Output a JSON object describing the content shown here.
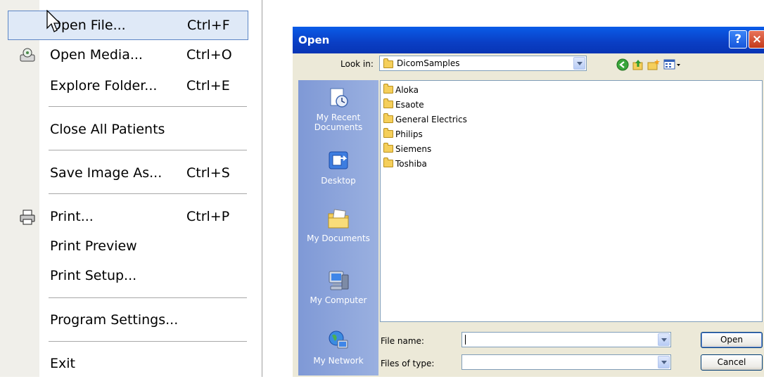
{
  "menu": {
    "items": [
      {
        "label": "Open File...",
        "shortcut": "Ctrl+F"
      },
      {
        "label": "Open Media...",
        "shortcut": "Ctrl+O"
      },
      {
        "label": "Explore Folder...",
        "shortcut": "Ctrl+E"
      },
      {
        "label": "Close All Patients",
        "shortcut": ""
      },
      {
        "label": "Save Image As...",
        "shortcut": "Ctrl+S"
      },
      {
        "label": "Print...",
        "shortcut": "Ctrl+P"
      },
      {
        "label": "Print Preview",
        "shortcut": ""
      },
      {
        "label": "Print Setup...",
        "shortcut": ""
      },
      {
        "label": "Program Settings...",
        "shortcut": ""
      },
      {
        "label": "Exit",
        "shortcut": ""
      }
    ],
    "icons": [
      "media-icon",
      "printer-icon"
    ]
  },
  "dialog": {
    "title": "Open",
    "help_label": "?",
    "close_label": "×",
    "look_in_label": "Look in:",
    "look_in_value": "DicomSamples",
    "places": [
      "My Recent Documents",
      "Desktop",
      "My Documents",
      "My Computer",
      "My Network"
    ],
    "places_lines": {
      "recent_1": "My Recent",
      "recent_2": "Documents"
    },
    "folders": [
      "Aloka",
      "Esaote",
      "General Electrics",
      "Philips",
      "Siemens",
      "Toshiba"
    ],
    "file_name_label": "File name:",
    "file_name_value": "",
    "files_of_type_label": "Files of type:",
    "files_of_type_value": "",
    "open_button": "Open",
    "cancel_button": "Cancel"
  },
  "colors": {
    "title_bar": "#0a4ed6",
    "menu_highlight": "#dfe9f7",
    "places_bar": "#8aa3da"
  }
}
